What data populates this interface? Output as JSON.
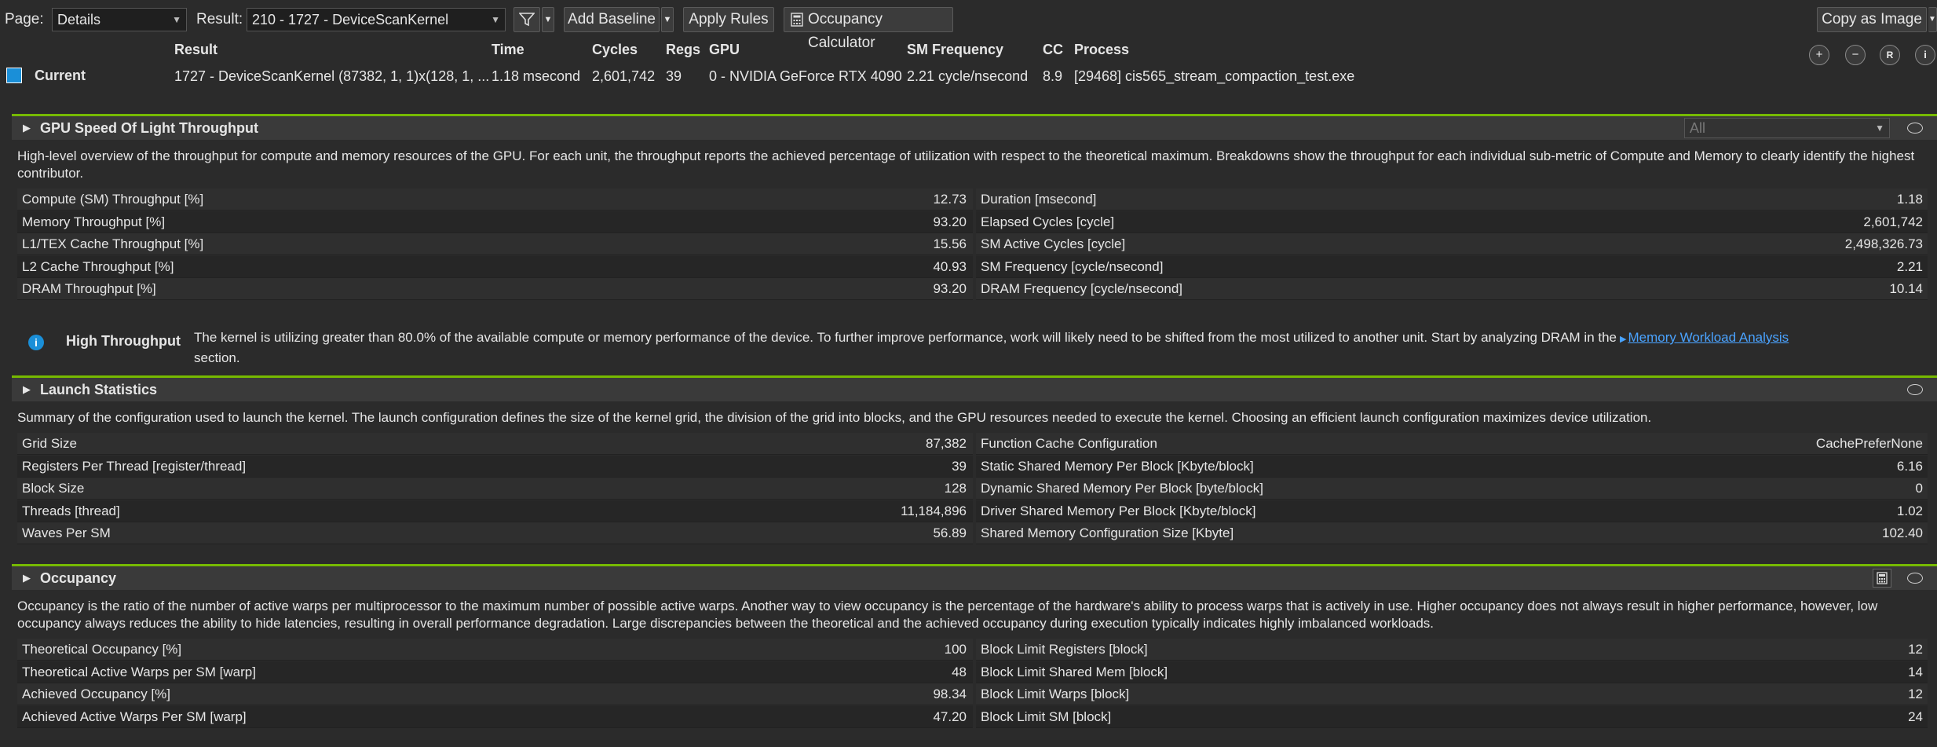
{
  "toolbar": {
    "page_label": "Page:",
    "page_value": "Details",
    "result_label": "Result:",
    "result_value": "210 -  1727 - DeviceScanKernel",
    "add_baseline": "Add Baseline",
    "apply_rules": "Apply Rules",
    "occupancy_calculator": "Occupancy Calculator",
    "copy_as_image": "Copy as Image"
  },
  "summary": {
    "headers": [
      "Result",
      "Time",
      "Cycles",
      "Regs",
      "GPU",
      "SM Frequency",
      "CC",
      "Process"
    ],
    "label": "Current",
    "swatch_color": "#1a8fd8",
    "values": [
      "1727 - DeviceScanKernel (87382, 1, 1)x(128, 1, ...",
      "1.18 msecond",
      "2,601,742",
      "39",
      "0 - NVIDIA GeForce RTX 4090",
      "2.21 cycle/nsecond",
      "8.9",
      "[29468] cis565_stream_compaction_test.exe"
    ]
  },
  "sections": [
    {
      "title": "GPU Speed Of Light Throughput",
      "filter": "All",
      "description": "High-level overview of the throughput for compute and memory resources of the GPU. For each unit, the throughput reports the achieved percentage of utilization with respect to the theoretical maximum. Breakdowns show the throughput for each individual sub-metric of Compute and Memory to clearly identify the highest contributor.",
      "left": [
        [
          "Compute (SM) Throughput [%]",
          "12.73"
        ],
        [
          "Memory Throughput [%]",
          "93.20"
        ],
        [
          "L1/TEX Cache Throughput [%]",
          "15.56"
        ],
        [
          "L2 Cache Throughput [%]",
          "40.93"
        ],
        [
          "DRAM Throughput [%]",
          "93.20"
        ]
      ],
      "right": [
        [
          "Duration [msecond]",
          "1.18"
        ],
        [
          "Elapsed Cycles [cycle]",
          "2,601,742"
        ],
        [
          "SM Active Cycles [cycle]",
          "2,498,326.73"
        ],
        [
          "SM Frequency [cycle/nsecond]",
          "2.21"
        ],
        [
          "DRAM Frequency [cycle/nsecond]",
          "10.14"
        ]
      ],
      "rule": {
        "title": "High Throughput",
        "text1": "The kernel is utilizing greater than 80.0% of the available compute or memory performance of the device. To further improve performance, work will likely need to be shifted from the most utilized to another unit. Start by analyzing DRAM in the",
        "link": "Memory Workload Analysis",
        "text2": "section."
      }
    },
    {
      "title": "Launch Statistics",
      "description": "Summary of the configuration used to launch the kernel. The launch configuration defines the size of the kernel grid, the division of the grid into blocks, and the GPU resources needed to execute the kernel. Choosing an efficient launch configuration maximizes device utilization.",
      "left": [
        [
          "Grid Size",
          "87,382"
        ],
        [
          "Registers Per Thread [register/thread]",
          "39"
        ],
        [
          "Block Size",
          "128"
        ],
        [
          "Threads [thread]",
          "11,184,896"
        ],
        [
          "Waves Per SM",
          "56.89"
        ]
      ],
      "right": [
        [
          "Function Cache Configuration",
          "CachePreferNone"
        ],
        [
          "Static Shared Memory Per Block [Kbyte/block]",
          "6.16"
        ],
        [
          "Dynamic Shared Memory Per Block [byte/block]",
          "0"
        ],
        [
          "Driver Shared Memory Per Block [Kbyte/block]",
          "1.02"
        ],
        [
          "Shared Memory Configuration Size [Kbyte]",
          "102.40"
        ]
      ]
    },
    {
      "title": "Occupancy",
      "description": "Occupancy is the ratio of the number of active warps per multiprocessor to the maximum number of possible active warps. Another way to view occupancy is the percentage of the hardware's ability to process warps that is actively in use. Higher occupancy does not always result in higher performance, however, low occupancy always reduces the ability to hide latencies, resulting in overall performance degradation. Large discrepancies between the theoretical and the achieved occupancy during execution typically indicates highly imbalanced workloads.",
      "left": [
        [
          "Theoretical Occupancy [%]",
          "100"
        ],
        [
          "Theoretical Active Warps per SM [warp]",
          "48"
        ],
        [
          "Achieved Occupancy [%]",
          "98.34"
        ],
        [
          "Achieved Active Warps Per SM [warp]",
          "47.20"
        ]
      ],
      "right": [
        [
          "Block Limit Registers [block]",
          "12"
        ],
        [
          "Block Limit Shared Mem [block]",
          "14"
        ],
        [
          "Block Limit Warps [block]",
          "12"
        ],
        [
          "Block Limit SM [block]",
          "24"
        ]
      ]
    }
  ],
  "colors": {
    "accent": "#76b900",
    "link": "#4aa3ff",
    "info": "#1a8fd8"
  },
  "icons": [
    "filter-icon",
    "calculator-icon",
    "zoom-in-icon",
    "zoom-out-icon",
    "reset-icon",
    "info-icon",
    "comment-icon",
    "expand-triangle-icon"
  ]
}
